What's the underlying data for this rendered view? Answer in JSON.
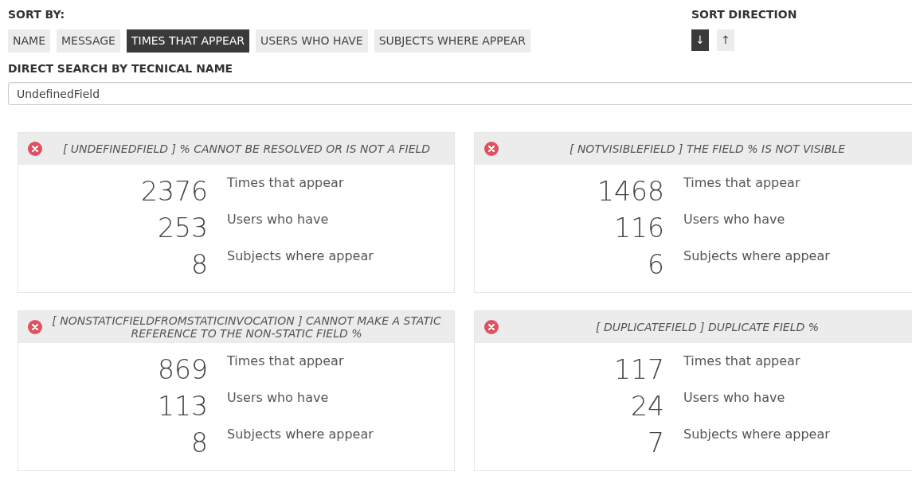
{
  "sort_by": {
    "label": "SORT BY:",
    "options": [
      {
        "label": "NAME",
        "selected": false
      },
      {
        "label": "MESSAGE",
        "selected": false
      },
      {
        "label": "TIMES THAT APPEAR",
        "selected": true
      },
      {
        "label": "USERS WHO HAVE",
        "selected": false
      },
      {
        "label": "SUBJECTS WHERE APPEAR",
        "selected": false
      }
    ]
  },
  "sort_direction": {
    "label": "SORT DIRECTION",
    "options": [
      {
        "label": "↓",
        "selected": true
      },
      {
        "label": "↑",
        "selected": false
      }
    ]
  },
  "search": {
    "label": "DIRECT SEARCH BY TECNICAL NAME",
    "value": "UndefinedField"
  },
  "cards": [
    {
      "title": "[ UNDEFINEDFIELD ] % CANNOT BE RESOLVED OR IS NOT A FIELD",
      "stats": [
        {
          "value": "2376",
          "label": "Times that appear"
        },
        {
          "value": "253",
          "label": "Users who have"
        },
        {
          "value": "8",
          "label": "Subjects where appear"
        }
      ]
    },
    {
      "title": "[ NOTVISIBLEFIELD ] THE FIELD % IS NOT VISIBLE",
      "stats": [
        {
          "value": "1468",
          "label": "Times that appear"
        },
        {
          "value": "116",
          "label": "Users who have"
        },
        {
          "value": "6",
          "label": "Subjects where appear"
        }
      ]
    },
    {
      "title": "[ NONSTATICFIELDFROMSTATICINVOCATION ] CANNOT MAKE A STATIC REFERENCE TO THE NON-STATIC FIELD %",
      "stats": [
        {
          "value": "869",
          "label": "Times that appear"
        },
        {
          "value": "113",
          "label": "Users who have"
        },
        {
          "value": "8",
          "label": "Subjects where appear"
        }
      ]
    },
    {
      "title": "[ DUPLICATEFIELD ] DUPLICATE FIELD %",
      "stats": [
        {
          "value": "117",
          "label": "Times that appear"
        },
        {
          "value": "24",
          "label": "Users who have"
        },
        {
          "value": "7",
          "label": "Subjects where appear"
        }
      ]
    }
  ]
}
